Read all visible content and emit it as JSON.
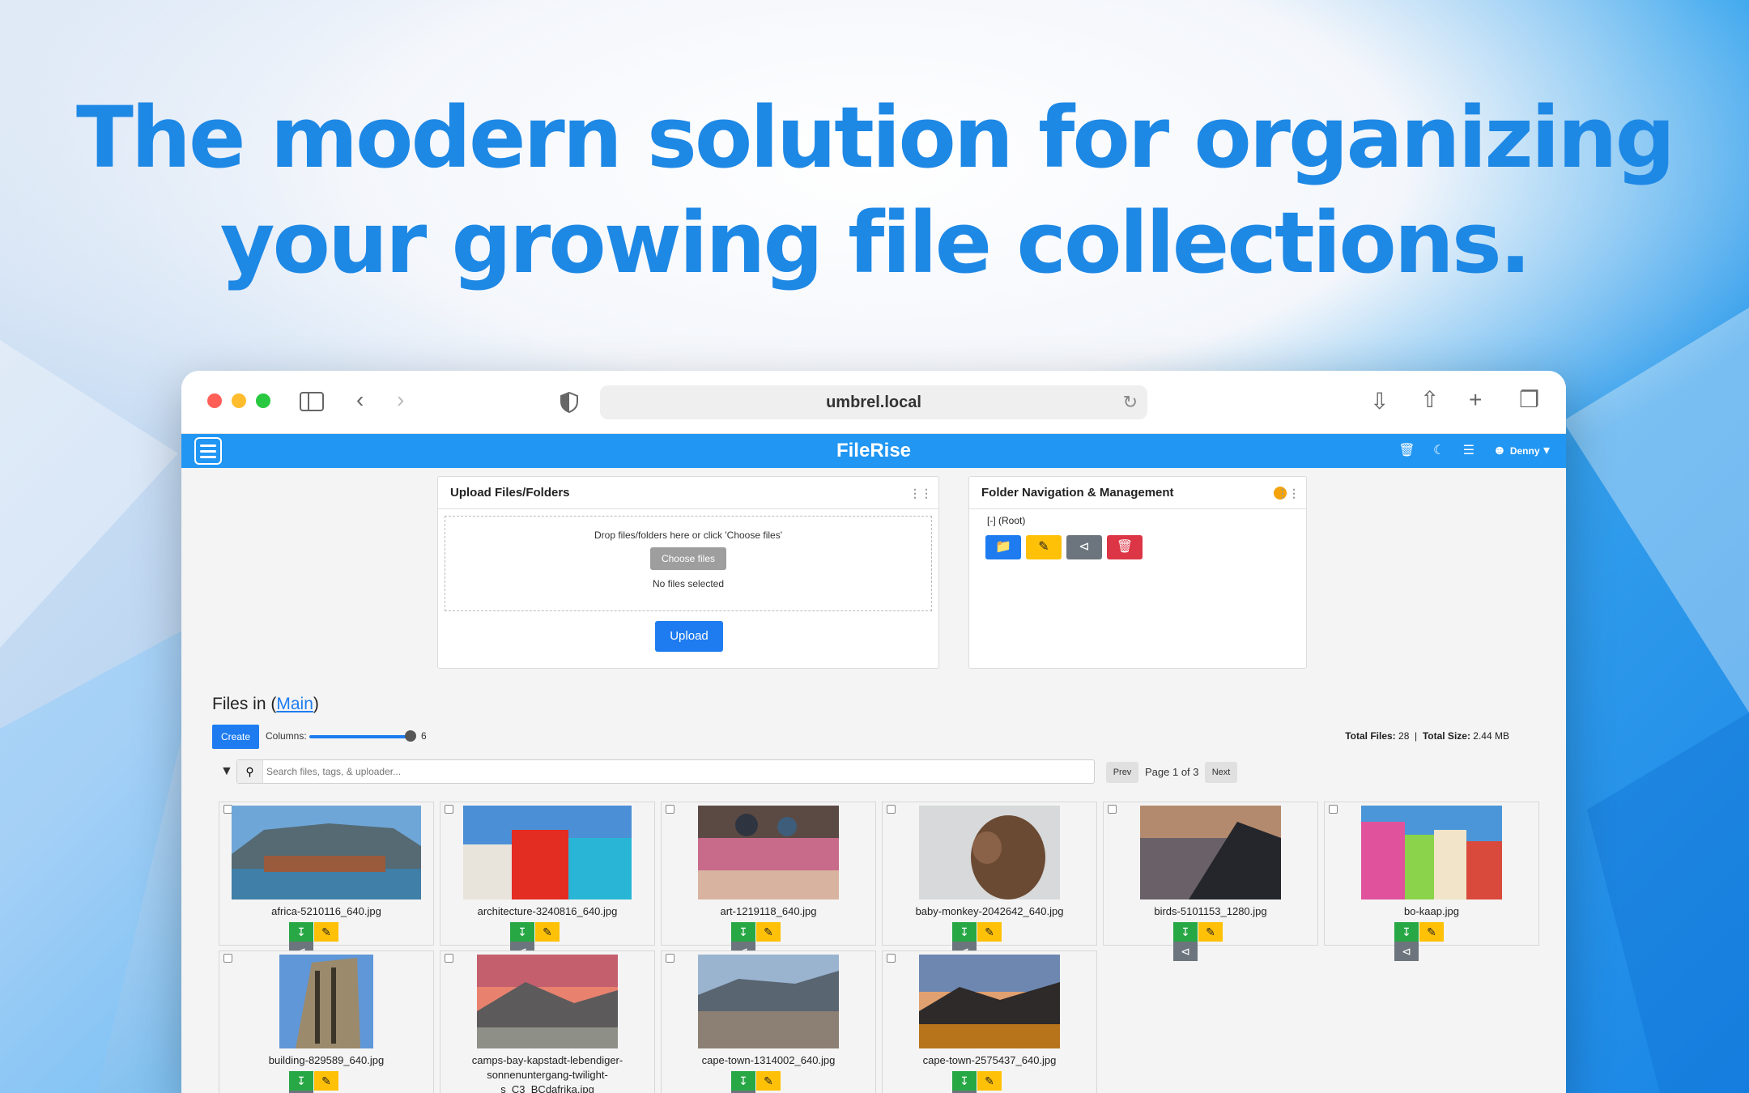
{
  "headline": {
    "line1": "The modern solution for organizing",
    "line2": "your growing file collections."
  },
  "browser": {
    "url": "umbrel.local"
  },
  "app": {
    "title": "FileRise",
    "user": "Denny"
  },
  "upload": {
    "title": "Upload Files/Folders",
    "drop_hint": "Drop files/folders here or click 'Choose files'",
    "choose_label": "Choose files",
    "no_files": "No files selected",
    "upload_label": "Upload"
  },
  "folders": {
    "title": "Folder Navigation & Management",
    "tree_root": "[-]  (Root)"
  },
  "files": {
    "title_prefix": "Files in (",
    "folder": "Main",
    "title_suffix": ")",
    "create_label": "Create",
    "columns_label": "Columns:",
    "columns_value": "6",
    "total_files_label": "Total Files:",
    "total_files": "28",
    "total_size_label": "Total Size:",
    "total_size": "2.44 MB",
    "search_placeholder": "Search files, tags, & uploader...",
    "prev_label": "Prev",
    "page_text": "Page 1 of 3",
    "next_label": "Next",
    "items": [
      {
        "name": "africa-5210116_640.jpg"
      },
      {
        "name": "architecture-3240816_640.jpg"
      },
      {
        "name": "art-1219118_640.jpg"
      },
      {
        "name": "baby-monkey-2042642_640.jpg"
      },
      {
        "name": "birds-5101153_1280.jpg"
      },
      {
        "name": "bo-kaap.jpg"
      },
      {
        "name": "building-829589_640.jpg"
      },
      {
        "name": "camps-bay-kapstadt-lebendiger-sonnenuntergang-twilight-s_C3_BCdafrika.jpg"
      },
      {
        "name": "cape-town-1314002_640.jpg"
      },
      {
        "name": "cape-town-2575437_640.jpg"
      }
    ]
  },
  "colors": {
    "primary": "#2196f3",
    "headline": "#1e88e5",
    "download": "#28a745",
    "rename": "#ffc107",
    "share": "#6c757d",
    "delete": "#dc3545"
  }
}
